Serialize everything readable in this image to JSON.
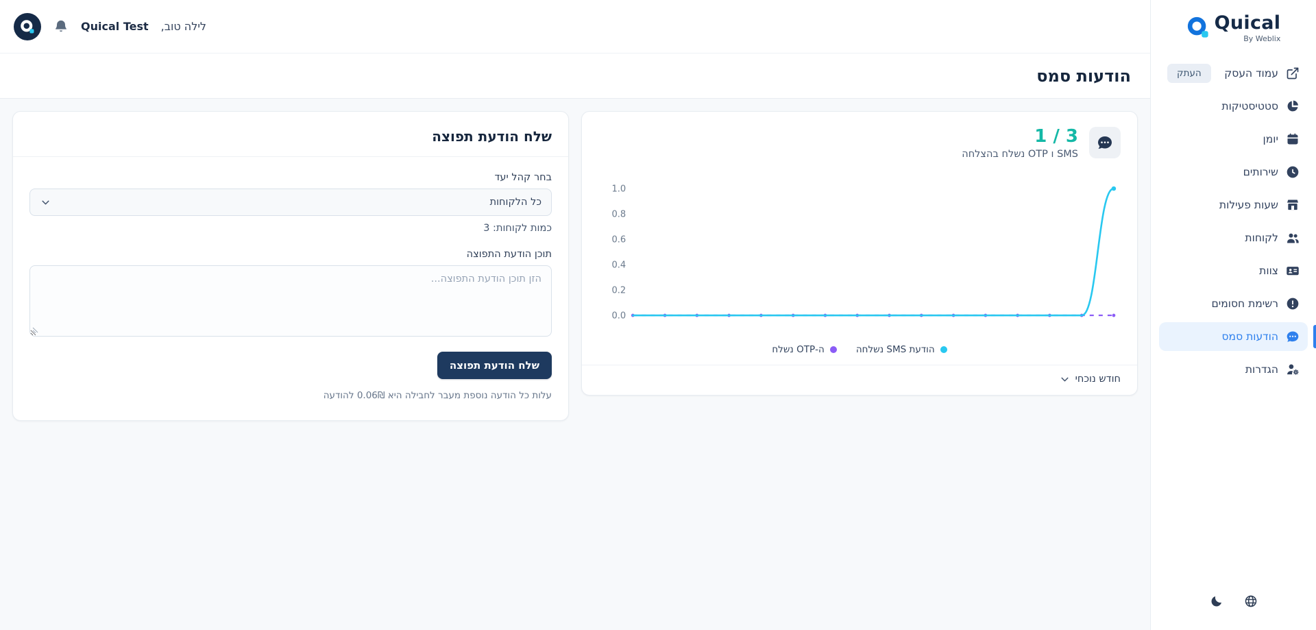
{
  "colors": {
    "accent_blue": "#2f80ed",
    "brand_blue": "#1273dd",
    "brand_cyan": "#29c8f0",
    "success_teal": "#14b8a6",
    "series_cyan": "#29c8f0",
    "series_purple": "#8b5cf6",
    "button_navy": "#1e3a5f"
  },
  "brand": {
    "name": "Quical",
    "byline": "By Weblix"
  },
  "topbar": {
    "greeting": "לילה טוב,",
    "account_name": "Quical Test"
  },
  "page": {
    "title": "הודעות סמס"
  },
  "sidebar": {
    "items": [
      {
        "id": "business-page",
        "label": "עמוד העסק",
        "icon": "external-link-icon",
        "action_label": "העתק"
      },
      {
        "id": "statistics",
        "label": "סטטיסטיקות",
        "icon": "pie-chart-icon"
      },
      {
        "id": "calendar",
        "label": "יומן",
        "icon": "calendar-icon"
      },
      {
        "id": "services",
        "label": "שירותים",
        "icon": "clock-icon"
      },
      {
        "id": "business-hours",
        "label": "שעות פעילות",
        "icon": "storefront-icon"
      },
      {
        "id": "customers",
        "label": "לקוחות",
        "icon": "users-icon"
      },
      {
        "id": "team",
        "label": "צוות",
        "icon": "id-card-icon"
      },
      {
        "id": "blocked-list",
        "label": "רשימת חסומים",
        "icon": "alert-circle-icon"
      },
      {
        "id": "sms-messages",
        "label": "הודעות סמס",
        "icon": "chat-icon",
        "active": true
      },
      {
        "id": "settings",
        "label": "הגדרות",
        "icon": "user-gear-icon"
      }
    ]
  },
  "stats_card": {
    "count": "1 / 3",
    "subtitle": "SMS ו OTP נשלח בהצלחה",
    "period_label": "חודש נוכחי"
  },
  "form_card": {
    "title": "שלח הודעת תפוצה",
    "audience_label": "בחר קהל יעד",
    "audience_value": "כל הלקוחות",
    "audience_count": "כמות לקוחות: 3",
    "message_label": "תוכן הודעת התפוצה",
    "message_placeholder": "הזן תוכן הודעת התפוצה...",
    "submit_label": "שלח הודעת תפוצה",
    "footnote": "עלות כל הודעה נוספת מעבר לחבילה היא 0.06₪ להודעה"
  },
  "chart_data": {
    "type": "line",
    "title": "",
    "xlabel": "",
    "ylabel": "",
    "ylim": [
      0,
      1
    ],
    "y_ticks": [
      "1.0",
      "0.8",
      "0.6",
      "0.4",
      "0.2",
      "0.0"
    ],
    "x_count": 16,
    "grid": false,
    "legend_position": "bottom",
    "series": [
      {
        "name": "הודעת SMS נשלחה",
        "color": "#29c8f0",
        "style": "solid",
        "values": [
          0,
          0,
          0,
          0,
          0,
          0,
          0,
          0,
          0,
          0,
          0,
          0,
          0,
          0,
          0,
          1
        ]
      },
      {
        "name": "ה-OTP נשלח",
        "color": "#8b5cf6",
        "style": "dashed",
        "values": [
          0,
          0,
          0,
          0,
          0,
          0,
          0,
          0,
          0,
          0,
          0,
          0,
          0,
          0,
          0,
          0
        ]
      }
    ]
  }
}
